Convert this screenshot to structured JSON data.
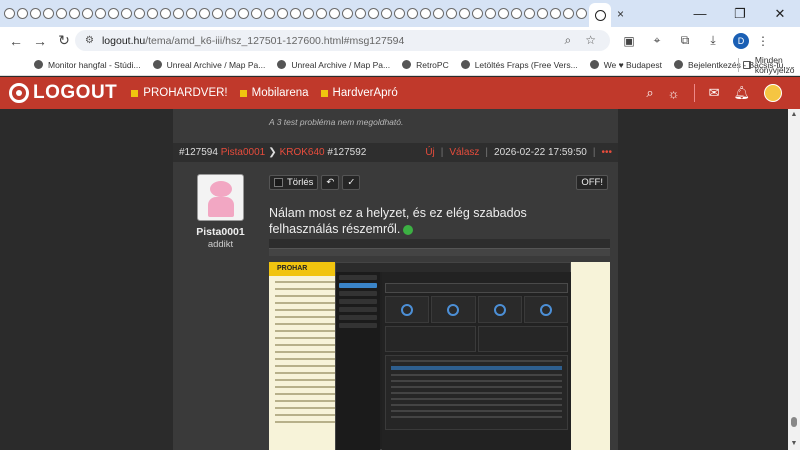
{
  "browser": {
    "url_host": "logout.hu",
    "url_path": "/tema/amd_k6-iii/hsz_127501-127600.html#msg127594",
    "tab_close": "×",
    "bookmarks": [
      "Monitor hangfal - Stúdi...",
      "Unreal Archive / Map Pa...",
      "Unreal Archive / Map Pa...",
      "RetroPC",
      "Letöltés Fraps (Free Vers...",
      "We ♥ Budapest",
      "Bejelentkezés - Bacsis-tu..."
    ],
    "bookmarks_folder": "Minden könyvjelző",
    "profile_initial": "D"
  },
  "site": {
    "logo": "LOGOUT",
    "nav": [
      "PROHARDVER!",
      "Mobilarena",
      "HardverApró"
    ],
    "brand_color": "#c0392b",
    "nav_square_color": "#f1c40f"
  },
  "thread": {
    "prev_quote": "A 3 test probléma nem megoldható."
  },
  "post": {
    "id": "#127594",
    "author": "Pista0001",
    "reply_to": "KROK640",
    "reply_id": "#127592",
    "new_label": "Új",
    "reply_label": "Válasz",
    "timestamp": "2026-02-22 17:59:50",
    "more": "•••",
    "author_rank": "addikt",
    "delete_label": "Törlés",
    "off_label": "OFF!",
    "text": "Nálam most ez a helyzet, és ez elég szabados felhasználás részemről."
  },
  "embedded_screenshot": {
    "site_title": "PROHAR"
  }
}
